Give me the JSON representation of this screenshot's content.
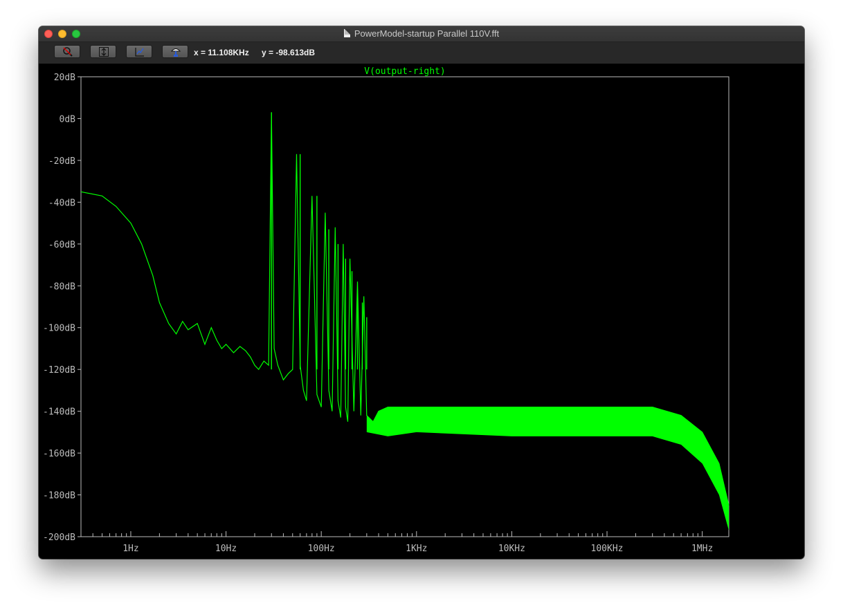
{
  "window": {
    "title": "PowerModel-startup Parallel 110V.fft"
  },
  "toolbar": {
    "buttons": [
      {
        "icon": "zoom-cancel-icon"
      },
      {
        "icon": "autorange-y-icon"
      },
      {
        "icon": "fit-x-icon"
      },
      {
        "icon": "paste-probe-icon"
      }
    ],
    "cursor_x": "x = 11.108KHz",
    "cursor_y": "y = -98.613dB"
  },
  "colors": {
    "trace": "#00ff00",
    "background": "#000000",
    "grid_text": "#bdbdbd",
    "frame": "#bdbdbd"
  },
  "chart_data": {
    "type": "line",
    "title": "V(output-right)",
    "x_scale": "log",
    "xlim": [
      0.3,
      1900000
    ],
    "ylim": [
      -200,
      20
    ],
    "y_ticks": [
      20,
      0,
      -20,
      -40,
      -60,
      -80,
      -100,
      -120,
      -140,
      -160,
      -180,
      -200
    ],
    "y_tick_labels": [
      "20dB",
      "0dB",
      "-20dB",
      "-40dB",
      "-60dB",
      "-80dB",
      "-100dB",
      "-120dB",
      "-140dB",
      "-160dB",
      "-180dB",
      "-200dB"
    ],
    "x_ticks": [
      1,
      10,
      100,
      1000,
      10000,
      100000,
      1000000
    ],
    "x_tick_labels": [
      "1Hz",
      "10Hz",
      "100Hz",
      "1KHz",
      "10KHz",
      "100KHz",
      "1MHz"
    ],
    "grid": false,
    "series": [
      {
        "name": "V(output-right)",
        "x": [
          0.3,
          0.5,
          0.7,
          1,
          1.3,
          1.7,
          2,
          2.5,
          3,
          3.5,
          4,
          5,
          6,
          7,
          8,
          9,
          10,
          12,
          14,
          16,
          18,
          20,
          22,
          25,
          28,
          30,
          32,
          35,
          40,
          45,
          50,
          55,
          60,
          65,
          70,
          80,
          90,
          100,
          110,
          120,
          130,
          140,
          150,
          160,
          170,
          180,
          190,
          200,
          220,
          240,
          260,
          280,
          300,
          350,
          400,
          500,
          1000,
          10000,
          100000,
          300000,
          600000,
          1000000,
          1500000,
          1900000
        ],
        "y": [
          -35,
          -37,
          -42,
          -50,
          -60,
          -75,
          -88,
          -98,
          -103,
          -97,
          -101,
          -98,
          -108,
          -100,
          -106,
          -110,
          -108,
          -112,
          -109,
          -111,
          -114,
          -118,
          -120,
          -116,
          -118,
          3,
          -110,
          -118,
          -125,
          -122,
          -120,
          -17,
          -118,
          -130,
          -135,
          -37,
          -132,
          -138,
          -45,
          -130,
          -140,
          -52,
          -135,
          -143,
          -60,
          -138,
          -145,
          -67,
          -140,
          -78,
          -142,
          -85,
          -142,
          -145,
          -140,
          -138,
          -138,
          -138,
          -138,
          -138,
          -142,
          -150,
          -165,
          -185
        ]
      },
      {
        "name": "lower envelope",
        "x": [
          300,
          500,
          1000,
          10000,
          100000,
          300000,
          600000,
          1000000,
          1500000,
          1900000
        ],
        "y": [
          -150,
          -152,
          -150,
          -152,
          -152,
          -152,
          -156,
          -165,
          -180,
          -197
        ]
      }
    ],
    "peaks": [
      {
        "x": 30,
        "y": 3
      },
      {
        "x": 60,
        "y": -17
      },
      {
        "x": 90,
        "y": -37
      },
      {
        "x": 120,
        "y": -53
      },
      {
        "x": 150,
        "y": -60
      },
      {
        "x": 180,
        "y": -67
      },
      {
        "x": 210,
        "y": -73
      },
      {
        "x": 240,
        "y": -82
      },
      {
        "x": 270,
        "y": -88
      },
      {
        "x": 300,
        "y": -95
      }
    ]
  }
}
